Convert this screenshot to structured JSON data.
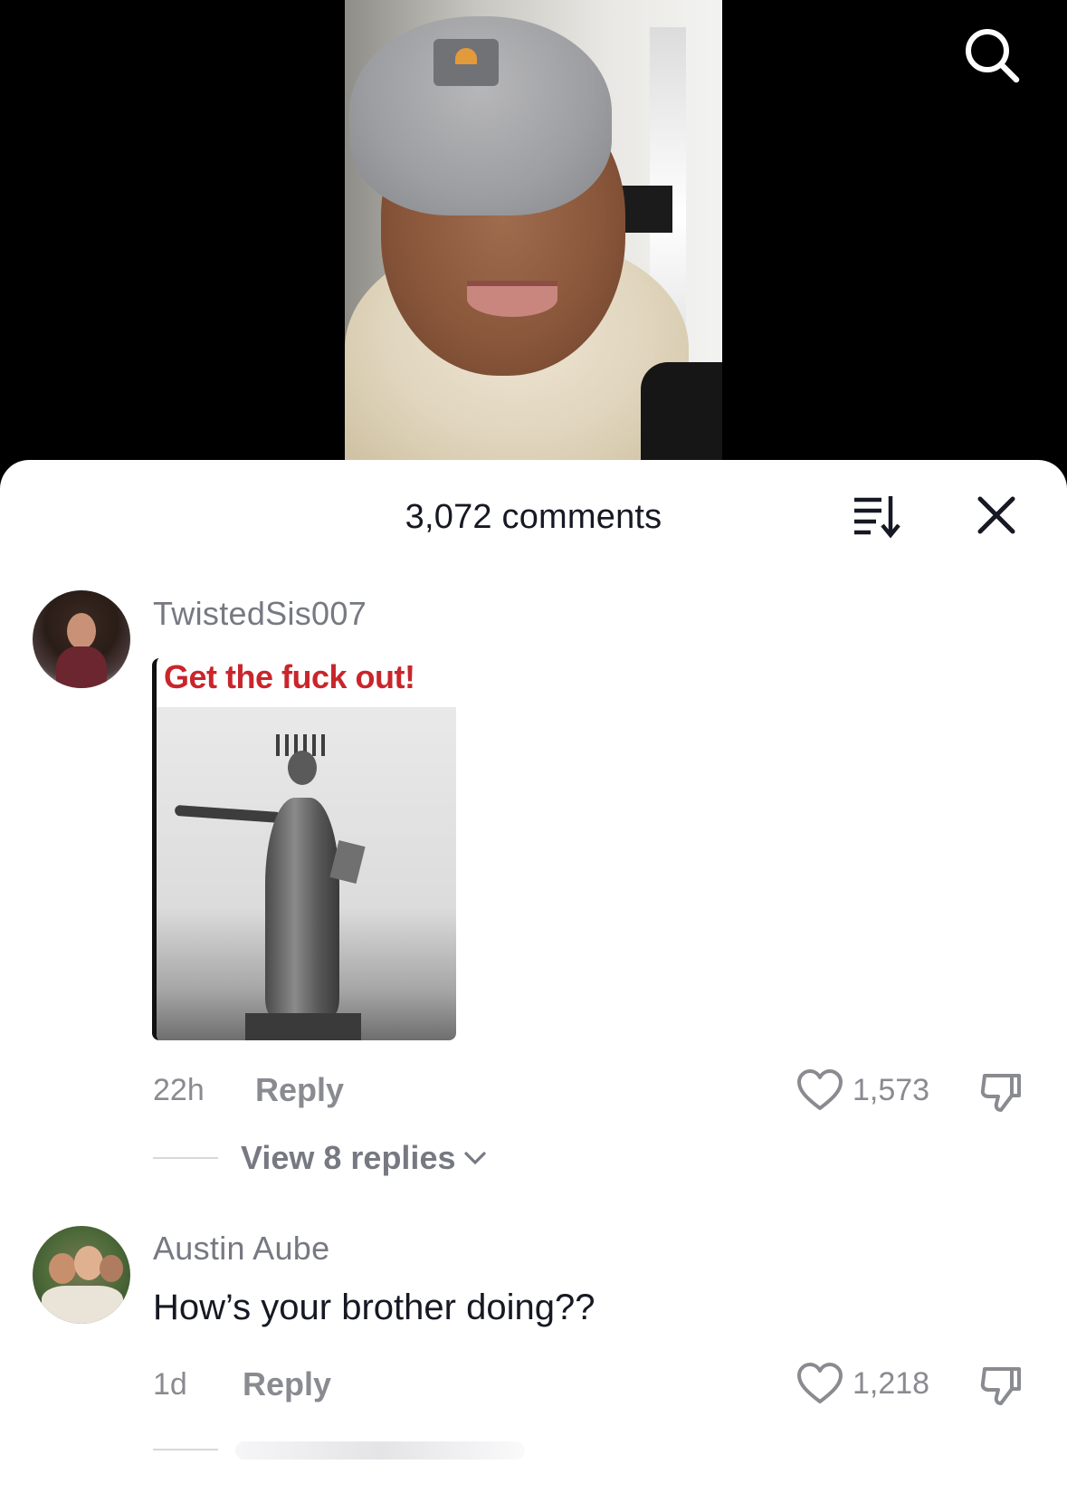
{
  "header": {
    "comment_count": "3,072 comments"
  },
  "icons": {
    "search": "search-icon",
    "sort": "sort-icon",
    "close": "close-icon",
    "like": "heart-icon",
    "dislike": "thumbs-down-icon",
    "expand": "chevron-down-icon"
  },
  "comments": [
    {
      "username": "TwistedSis007",
      "image_caption": "Get the fuck out!",
      "time": "22h",
      "reply_label": "Reply",
      "likes": "1,573",
      "view_replies": "View 8 replies"
    },
    {
      "username": "Austin Aube",
      "text": "How’s your brother doing??",
      "time": "1d",
      "reply_label": "Reply",
      "likes": "1,218"
    }
  ],
  "colors": {
    "sheet_bg": "#ffffff",
    "primary_text": "#161823",
    "secondary_text": "#8a8b91",
    "meme_caption": "#c8262c"
  }
}
